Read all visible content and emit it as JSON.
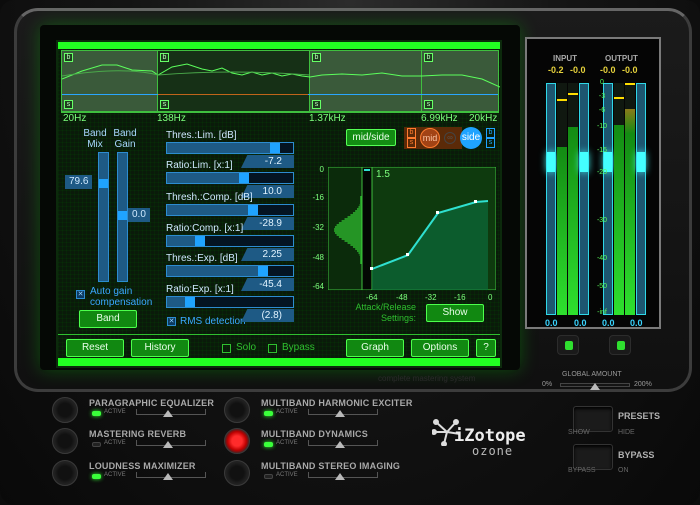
{
  "app": {
    "name": "iZotope Ozone",
    "tagline": "complete mastering system"
  },
  "spectrum": {
    "bands": [
      {
        "id": 1,
        "solo": "s",
        "bypass": "b",
        "active": false
      },
      {
        "id": 2,
        "solo": "s",
        "bypass": "b",
        "active": true
      },
      {
        "id": 3,
        "solo": "s",
        "bypass": "b",
        "active": false
      },
      {
        "id": 4,
        "solo": "s",
        "bypass": "b",
        "active": false
      }
    ],
    "freq_labels": [
      "20Hz",
      "138Hz",
      "1.37kHz",
      "6.99kHz",
      "20kHz"
    ]
  },
  "mid_side": {
    "button": "mid/side",
    "mid": "mid",
    "side": "side",
    "link_icon": "link-icon",
    "b": "b",
    "s": "s"
  },
  "band_controls": {
    "band_mix_label": "Band Mix",
    "band_gain_label": "Band Gain",
    "band_mix_value": "79.6",
    "band_gain_value": "0.0",
    "band_mix_level": 0.796,
    "auto_gain_label": "Auto gain compensation",
    "auto_gain_checked": true,
    "band_button": "Band"
  },
  "dynamics": [
    {
      "label": "Thres.:Lim. [dB]",
      "value": "-7.2",
      "fill": 0.9
    },
    {
      "label": "Ratio:Lim. [x:1]",
      "value": "10.0",
      "fill": 0.65
    },
    {
      "label": "Thresh.:Comp. [dB]",
      "value": "-28.9",
      "fill": 0.72
    },
    {
      "label": "Ratio:Comp. [x:1]",
      "value": "2.25",
      "fill": 0.3
    },
    {
      "label": "Thres.:Exp. [dB]",
      "value": "-45.4",
      "fill": 0.8
    },
    {
      "label": "Ratio:Exp. [x:1]",
      "value": "(2.8)",
      "fill": 0.22
    }
  ],
  "rms_detection": {
    "label": "RMS detection",
    "checked": true
  },
  "graph": {
    "y_ticks": [
      "0",
      "-16",
      "-32",
      "-48",
      "-64"
    ],
    "x_ticks": [
      "-64",
      "-48",
      "-32",
      "-16",
      "0"
    ],
    "ratio_readout": "1.5",
    "attack_release_label": "Attack/Release Settings:",
    "show_button": "Show"
  },
  "bottom_bar": {
    "reset": "Reset",
    "history": "History",
    "solo": "Solo",
    "bypass": "Bypass",
    "graph": "Graph",
    "options": "Options",
    "help": "?"
  },
  "meters": {
    "input_label": "INPUT",
    "output_label": "OUTPUT",
    "input_peaks": [
      "-0.2",
      "-0.0"
    ],
    "output_peaks": [
      "-0.0",
      "-0.0"
    ],
    "scale": [
      "0",
      "-3",
      "-6",
      "-10",
      "-15",
      "-20",
      "-30",
      "-40",
      "-50",
      "-inf"
    ],
    "readouts": [
      "0.0",
      "0.0",
      "0.0",
      "0.0"
    ],
    "global_amount_label": "GLOBAL AMOUNT",
    "global_min": "0%",
    "global_max": "200%"
  },
  "modules": [
    {
      "name": "PARAGRAPHIC EQUALIZER",
      "active_label": "ACTIVE",
      "active": true,
      "selected": false
    },
    {
      "name": "MASTERING REVERB",
      "active_label": "ACTIVE",
      "active": false,
      "selected": false
    },
    {
      "name": "LOUDNESS MAXIMIZER",
      "active_label": "ACTIVE",
      "active": true,
      "selected": false
    },
    {
      "name": "MULTIBAND HARMONIC EXCITER",
      "active_label": "ACTIVE",
      "active": true,
      "selected": false
    },
    {
      "name": "MULTIBAND DYNAMICS",
      "active_label": "ACTIVE",
      "active": true,
      "selected": true
    },
    {
      "name": "MULTIBAND STEREO IMAGING",
      "active_label": "ACTIVE",
      "active": false,
      "selected": false
    }
  ],
  "logo": {
    "brand": "iZotope",
    "product": "ozone"
  },
  "switches": {
    "presets": {
      "label": "PRESETS",
      "left": "SHOW",
      "right": "HIDE"
    },
    "bypass": {
      "label": "BYPASS",
      "left": "BYPASS",
      "right": "ON"
    }
  }
}
